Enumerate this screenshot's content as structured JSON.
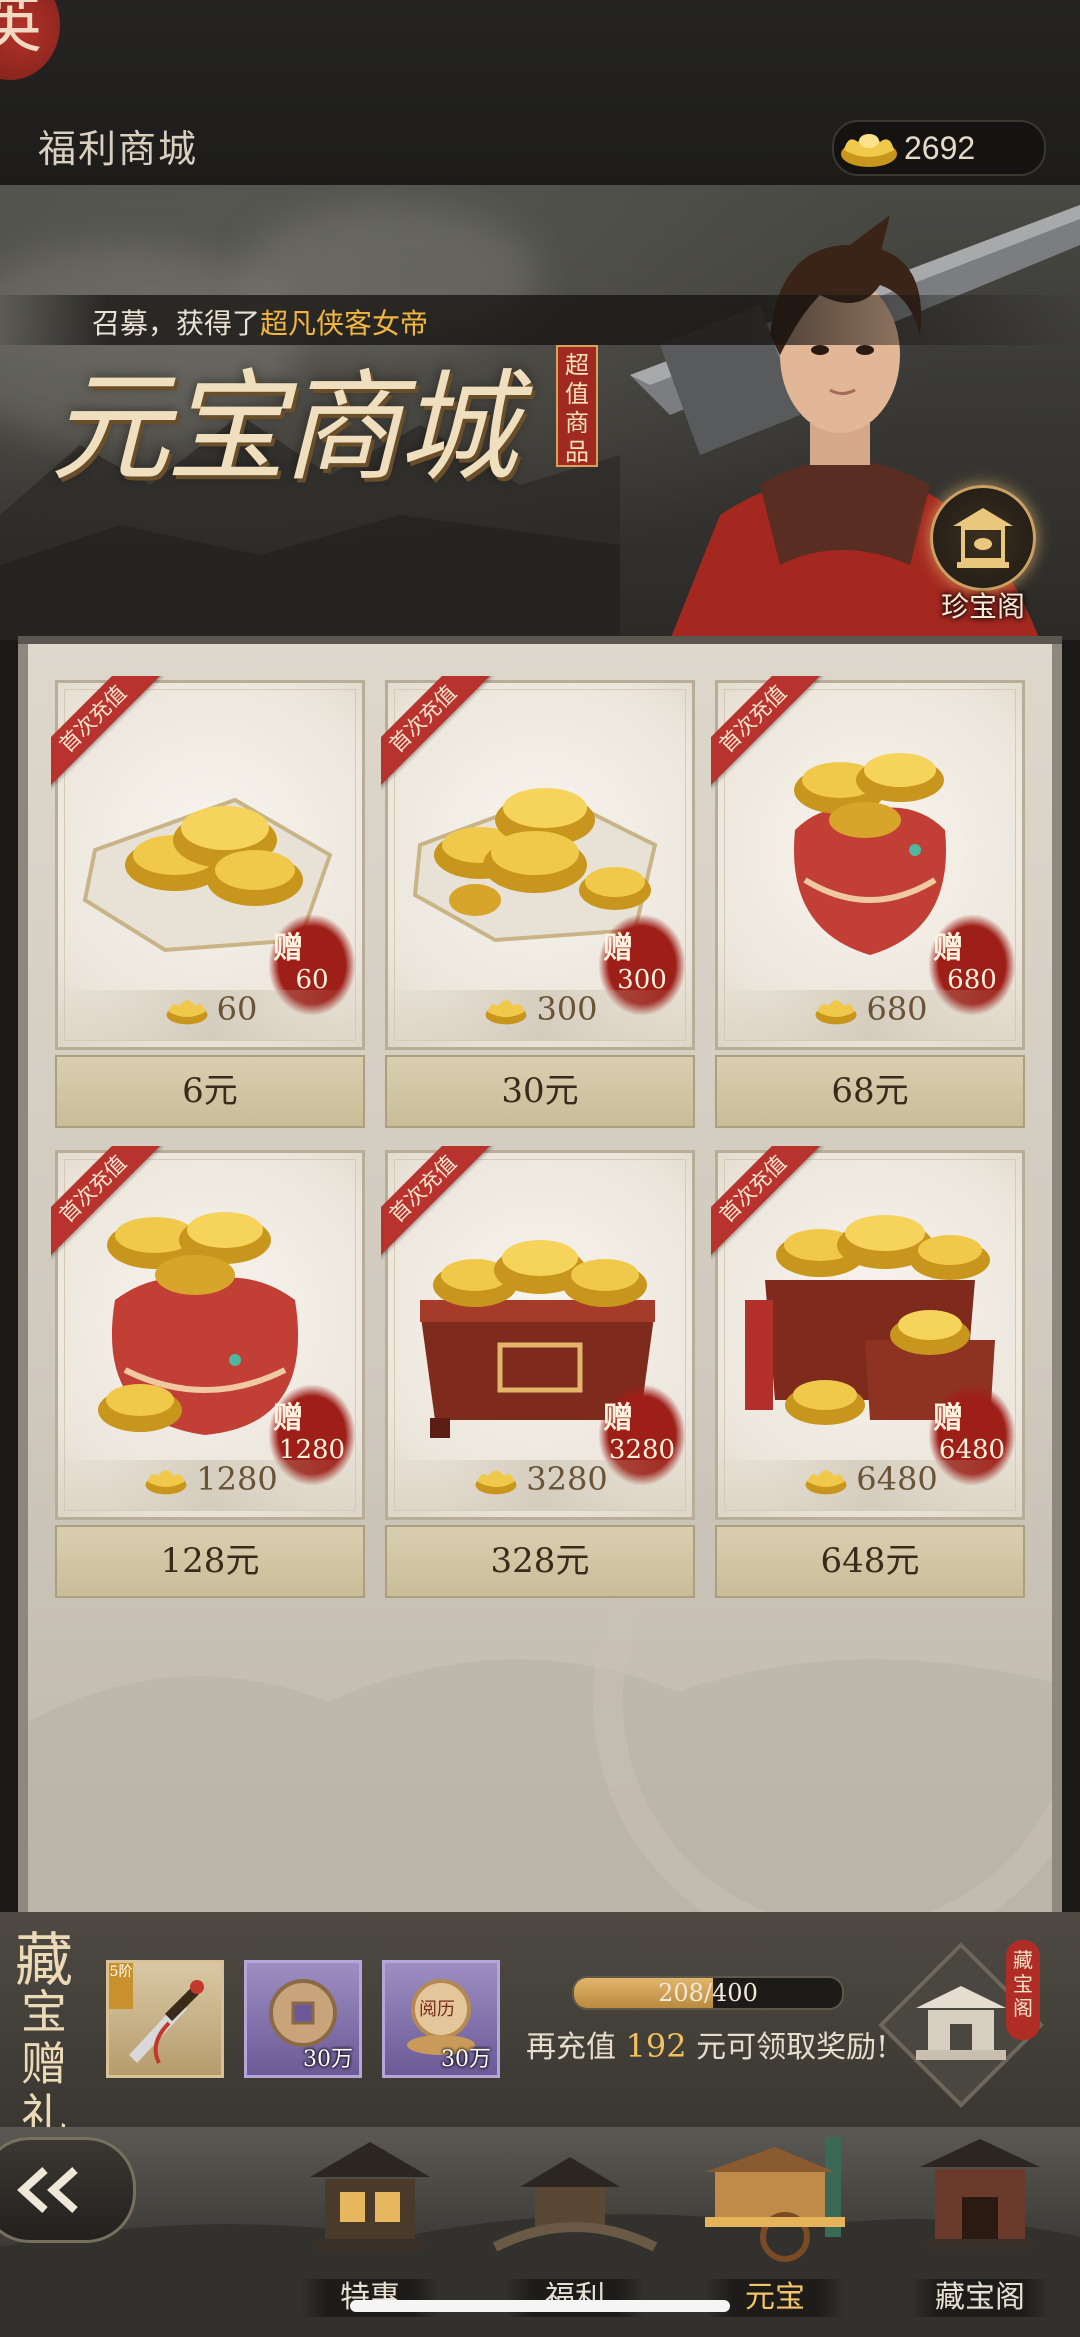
{
  "header": {
    "seal_char": "英",
    "title": "福利商城",
    "currency_icon": "gold-ingot-icon",
    "currency_amount": "2692"
  },
  "banner": {
    "ticker_prefix": "召募，获得了",
    "ticker_highlight": "超凡侠客女帝",
    "headline": "元宝商城",
    "value_tag": "超值商品",
    "treasure_button": "珍宝阁"
  },
  "shop": {
    "ribbon_text": "首次充值",
    "bonus_prefix": "赠",
    "items": [
      {
        "art": "ingots-on-cloth",
        "bonus": "60",
        "amount": "60",
        "price": "6元"
      },
      {
        "art": "ingots-pile-cloth",
        "bonus": "300",
        "amount": "300",
        "price": "30元"
      },
      {
        "art": "small-pouch",
        "bonus": "680",
        "amount": "680",
        "price": "68元"
      },
      {
        "art": "large-pouch",
        "bonus": "1280",
        "amount": "1280",
        "price": "128元"
      },
      {
        "art": "treasure-chest",
        "bonus": "3280",
        "amount": "3280",
        "price": "328元"
      },
      {
        "art": "big-treasure-chest",
        "bonus": "6480",
        "amount": "6480",
        "price": "648元"
      }
    ]
  },
  "gift": {
    "title_1": "藏",
    "title_2": "宝",
    "title_3": "赠",
    "title_4": "礼",
    "items": [
      {
        "icon": "dagger-icon",
        "tag": "5阶",
        "count": ""
      },
      {
        "icon": "copper-coin-icon",
        "tag": "",
        "count": "30万"
      },
      {
        "icon": "experience-orb-icon",
        "tag": "阅历",
        "count": "30万"
      }
    ],
    "progress_text": "208/400",
    "progress_fraction": 0.52,
    "hint_prefix": "再充值",
    "hint_amount": "192",
    "hint_suffix": "元可领取奖励!",
    "vault_label": "藏宝阁"
  },
  "nav": {
    "tabs": [
      {
        "label": "特惠",
        "active": false
      },
      {
        "label": "福利",
        "active": false
      },
      {
        "label": "元宝",
        "active": true
      },
      {
        "label": "藏宝阁",
        "active": false
      }
    ]
  },
  "colors": {
    "accent_gold": "#f2b640",
    "ribbon_red": "#b8332d",
    "panel_bg": "#ddd7cc"
  }
}
